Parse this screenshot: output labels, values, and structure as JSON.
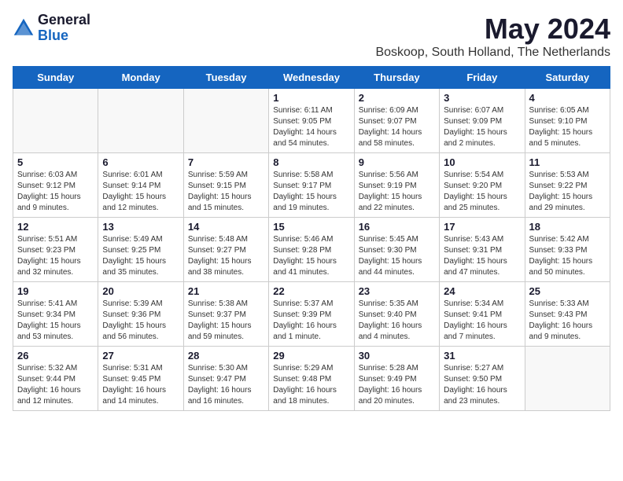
{
  "header": {
    "logo_general": "General",
    "logo_blue": "Blue",
    "month_title": "May 2024",
    "location": "Boskoop, South Holland, The Netherlands"
  },
  "days_of_week": [
    "Sunday",
    "Monday",
    "Tuesday",
    "Wednesday",
    "Thursday",
    "Friday",
    "Saturday"
  ],
  "weeks": [
    [
      {
        "day": "",
        "info": ""
      },
      {
        "day": "",
        "info": ""
      },
      {
        "day": "",
        "info": ""
      },
      {
        "day": "1",
        "info": "Sunrise: 6:11 AM\nSunset: 9:05 PM\nDaylight: 14 hours\nand 54 minutes."
      },
      {
        "day": "2",
        "info": "Sunrise: 6:09 AM\nSunset: 9:07 PM\nDaylight: 14 hours\nand 58 minutes."
      },
      {
        "day": "3",
        "info": "Sunrise: 6:07 AM\nSunset: 9:09 PM\nDaylight: 15 hours\nand 2 minutes."
      },
      {
        "day": "4",
        "info": "Sunrise: 6:05 AM\nSunset: 9:10 PM\nDaylight: 15 hours\nand 5 minutes."
      }
    ],
    [
      {
        "day": "5",
        "info": "Sunrise: 6:03 AM\nSunset: 9:12 PM\nDaylight: 15 hours\nand 9 minutes."
      },
      {
        "day": "6",
        "info": "Sunrise: 6:01 AM\nSunset: 9:14 PM\nDaylight: 15 hours\nand 12 minutes."
      },
      {
        "day": "7",
        "info": "Sunrise: 5:59 AM\nSunset: 9:15 PM\nDaylight: 15 hours\nand 15 minutes."
      },
      {
        "day": "8",
        "info": "Sunrise: 5:58 AM\nSunset: 9:17 PM\nDaylight: 15 hours\nand 19 minutes."
      },
      {
        "day": "9",
        "info": "Sunrise: 5:56 AM\nSunset: 9:19 PM\nDaylight: 15 hours\nand 22 minutes."
      },
      {
        "day": "10",
        "info": "Sunrise: 5:54 AM\nSunset: 9:20 PM\nDaylight: 15 hours\nand 25 minutes."
      },
      {
        "day": "11",
        "info": "Sunrise: 5:53 AM\nSunset: 9:22 PM\nDaylight: 15 hours\nand 29 minutes."
      }
    ],
    [
      {
        "day": "12",
        "info": "Sunrise: 5:51 AM\nSunset: 9:23 PM\nDaylight: 15 hours\nand 32 minutes."
      },
      {
        "day": "13",
        "info": "Sunrise: 5:49 AM\nSunset: 9:25 PM\nDaylight: 15 hours\nand 35 minutes."
      },
      {
        "day": "14",
        "info": "Sunrise: 5:48 AM\nSunset: 9:27 PM\nDaylight: 15 hours\nand 38 minutes."
      },
      {
        "day": "15",
        "info": "Sunrise: 5:46 AM\nSunset: 9:28 PM\nDaylight: 15 hours\nand 41 minutes."
      },
      {
        "day": "16",
        "info": "Sunrise: 5:45 AM\nSunset: 9:30 PM\nDaylight: 15 hours\nand 44 minutes."
      },
      {
        "day": "17",
        "info": "Sunrise: 5:43 AM\nSunset: 9:31 PM\nDaylight: 15 hours\nand 47 minutes."
      },
      {
        "day": "18",
        "info": "Sunrise: 5:42 AM\nSunset: 9:33 PM\nDaylight: 15 hours\nand 50 minutes."
      }
    ],
    [
      {
        "day": "19",
        "info": "Sunrise: 5:41 AM\nSunset: 9:34 PM\nDaylight: 15 hours\nand 53 minutes."
      },
      {
        "day": "20",
        "info": "Sunrise: 5:39 AM\nSunset: 9:36 PM\nDaylight: 15 hours\nand 56 minutes."
      },
      {
        "day": "21",
        "info": "Sunrise: 5:38 AM\nSunset: 9:37 PM\nDaylight: 15 hours\nand 59 minutes."
      },
      {
        "day": "22",
        "info": "Sunrise: 5:37 AM\nSunset: 9:39 PM\nDaylight: 16 hours\nand 1 minute."
      },
      {
        "day": "23",
        "info": "Sunrise: 5:35 AM\nSunset: 9:40 PM\nDaylight: 16 hours\nand 4 minutes."
      },
      {
        "day": "24",
        "info": "Sunrise: 5:34 AM\nSunset: 9:41 PM\nDaylight: 16 hours\nand 7 minutes."
      },
      {
        "day": "25",
        "info": "Sunrise: 5:33 AM\nSunset: 9:43 PM\nDaylight: 16 hours\nand 9 minutes."
      }
    ],
    [
      {
        "day": "26",
        "info": "Sunrise: 5:32 AM\nSunset: 9:44 PM\nDaylight: 16 hours\nand 12 minutes."
      },
      {
        "day": "27",
        "info": "Sunrise: 5:31 AM\nSunset: 9:45 PM\nDaylight: 16 hours\nand 14 minutes."
      },
      {
        "day": "28",
        "info": "Sunrise: 5:30 AM\nSunset: 9:47 PM\nDaylight: 16 hours\nand 16 minutes."
      },
      {
        "day": "29",
        "info": "Sunrise: 5:29 AM\nSunset: 9:48 PM\nDaylight: 16 hours\nand 18 minutes."
      },
      {
        "day": "30",
        "info": "Sunrise: 5:28 AM\nSunset: 9:49 PM\nDaylight: 16 hours\nand 20 minutes."
      },
      {
        "day": "31",
        "info": "Sunrise: 5:27 AM\nSunset: 9:50 PM\nDaylight: 16 hours\nand 23 minutes."
      },
      {
        "day": "",
        "info": ""
      }
    ]
  ]
}
